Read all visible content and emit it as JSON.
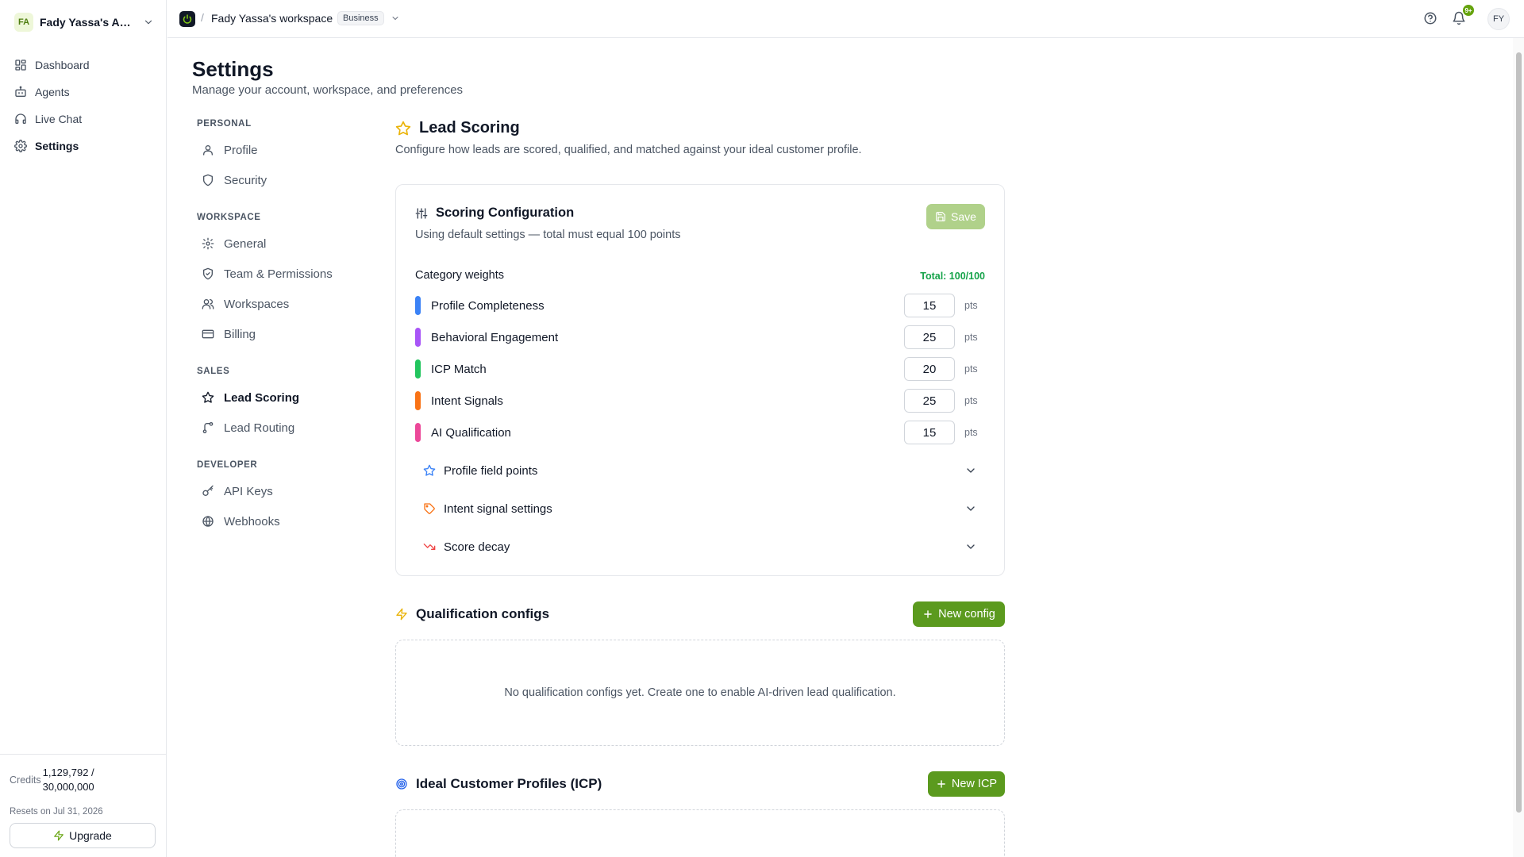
{
  "sidebar": {
    "account": {
      "initials": "FA",
      "name": "Fady Yassa's Acc..."
    },
    "nav": [
      {
        "label": "Dashboard",
        "icon": "dashboard-icon"
      },
      {
        "label": "Agents",
        "icon": "bot-icon"
      },
      {
        "label": "Live Chat",
        "icon": "headset-icon"
      },
      {
        "label": "Settings",
        "icon": "gear-icon",
        "active": true
      }
    ],
    "footer": {
      "credits_label": "Credits",
      "credits_value": "1,129,792 / 30,000,000",
      "resets": "Resets on Jul 31, 2026",
      "upgrade_label": "Upgrade"
    }
  },
  "topbar": {
    "separator": "/",
    "workspace_name": "Fady Yassa's workspace",
    "plan_badge": "Business",
    "notification_badge": "9+",
    "user_initials": "FY"
  },
  "page": {
    "title": "Settings",
    "subtitle": "Manage your account, workspace, and preferences"
  },
  "settings_nav": {
    "groups": [
      {
        "heading": "PERSONAL",
        "items": [
          {
            "label": "Profile",
            "icon": "user-icon"
          },
          {
            "label": "Security",
            "icon": "shield-icon"
          }
        ]
      },
      {
        "heading": "WORKSPACE",
        "items": [
          {
            "label": "General",
            "icon": "gear-icon"
          },
          {
            "label": "Team & Permissions",
            "icon": "shield-check-icon"
          },
          {
            "label": "Workspaces",
            "icon": "users-icon"
          },
          {
            "label": "Billing",
            "icon": "credit-card-icon"
          }
        ]
      },
      {
        "heading": "SALES",
        "items": [
          {
            "label": "Lead Scoring",
            "icon": "star-icon",
            "active": true
          },
          {
            "label": "Lead Routing",
            "icon": "git-branch-icon"
          }
        ]
      },
      {
        "heading": "DEVELOPER",
        "items": [
          {
            "label": "API Keys",
            "icon": "key-icon"
          },
          {
            "label": "Webhooks",
            "icon": "globe-icon"
          }
        ]
      }
    ]
  },
  "lead_scoring": {
    "title": "Lead Scoring",
    "subtitle": "Configure how leads are scored, qualified, and matched against your ideal customer profile.",
    "config": {
      "title": "Scoring Configuration",
      "subtitle": "Using default settings — total must equal 100 points",
      "save_label": "Save",
      "weights_label": "Category weights",
      "total_label": "Total: 100/100",
      "unit": "pts",
      "weights": [
        {
          "name": "Profile Completeness",
          "value": "15",
          "color": "#3b82f6"
        },
        {
          "name": "Behavioral Engagement",
          "value": "25",
          "color": "#a855f7"
        },
        {
          "name": "ICP Match",
          "value": "20",
          "color": "#22c55e"
        },
        {
          "name": "Intent Signals",
          "value": "25",
          "color": "#f97316"
        },
        {
          "name": "AI Qualification",
          "value": "15",
          "color": "#ec4899"
        }
      ],
      "sections": [
        {
          "label": "Profile field points",
          "icon": "star-icon",
          "color": "#3b82f6"
        },
        {
          "label": "Intent signal settings",
          "icon": "tag-icon",
          "color": "#f97316"
        },
        {
          "label": "Score decay",
          "icon": "trending-down-icon",
          "color": "#ef4444"
        }
      ]
    },
    "qualification": {
      "title": "Qualification configs",
      "button_label": "New config",
      "empty_text": "No qualification configs yet. Create one to enable AI-driven lead qualification."
    },
    "icp": {
      "title": "Ideal Customer Profiles (ICP)",
      "button_label": "New ICP"
    }
  },
  "colors": {
    "accent_green": "#5b9a1e",
    "total_green": "#16a34a",
    "save_disabled": "#a3c976"
  }
}
